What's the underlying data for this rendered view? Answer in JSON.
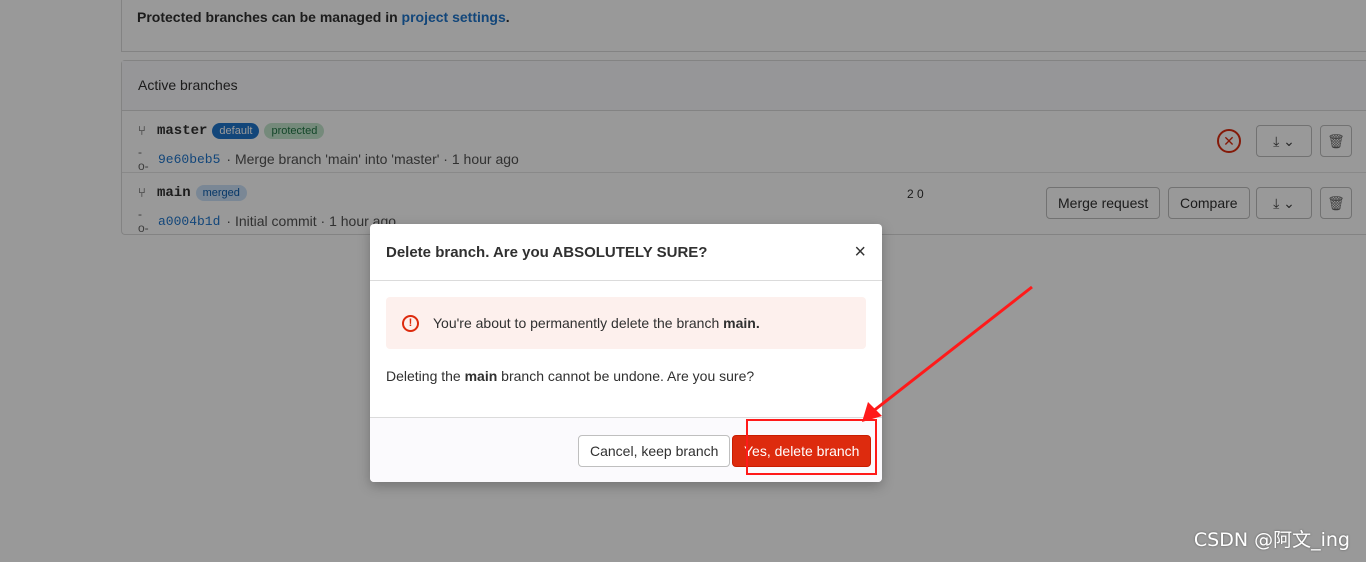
{
  "protected_note": {
    "text": "Protected branches can be managed in ",
    "link": "project settings",
    "suffix": "."
  },
  "active_branches": {
    "title": "Active branches",
    "rows": [
      {
        "name": "master",
        "badges": [
          "default",
          "protected"
        ],
        "sha": "9e60beb5",
        "commit_text": "· Merge branch 'main' into 'master' · 1 hour ago"
      },
      {
        "name": "main",
        "badges": [
          "merged"
        ],
        "sha": "a0004b1d",
        "commit_text": "· Initial commit · 1 hour ago",
        "divergence": "2 0",
        "merge_request_label": "Merge request",
        "compare_label": "Compare"
      }
    ]
  },
  "modal": {
    "title": "Delete branch. Are you ABSOLUTELY SURE?",
    "close_symbol": "×",
    "alert_text": "You're about to permanently delete the branch ",
    "alert_branch": "main.",
    "confirm_prefix": "Deleting the ",
    "confirm_branch": "main",
    "confirm_suffix": " branch cannot be undone. Are you sure?",
    "cancel_label": "Cancel, keep branch",
    "confirm_label": "Yes, delete branch"
  },
  "watermark": "CSDN @阿文_ing",
  "colors": {
    "danger": "#dd2b0e",
    "link": "#1f75cb",
    "annotation": "#ff1a1a"
  },
  "icons": {
    "branch": "git-branch-icon",
    "commit": "commit-icon",
    "download": "download-icon",
    "delete": "trash-icon",
    "error": "error-circle-icon"
  }
}
